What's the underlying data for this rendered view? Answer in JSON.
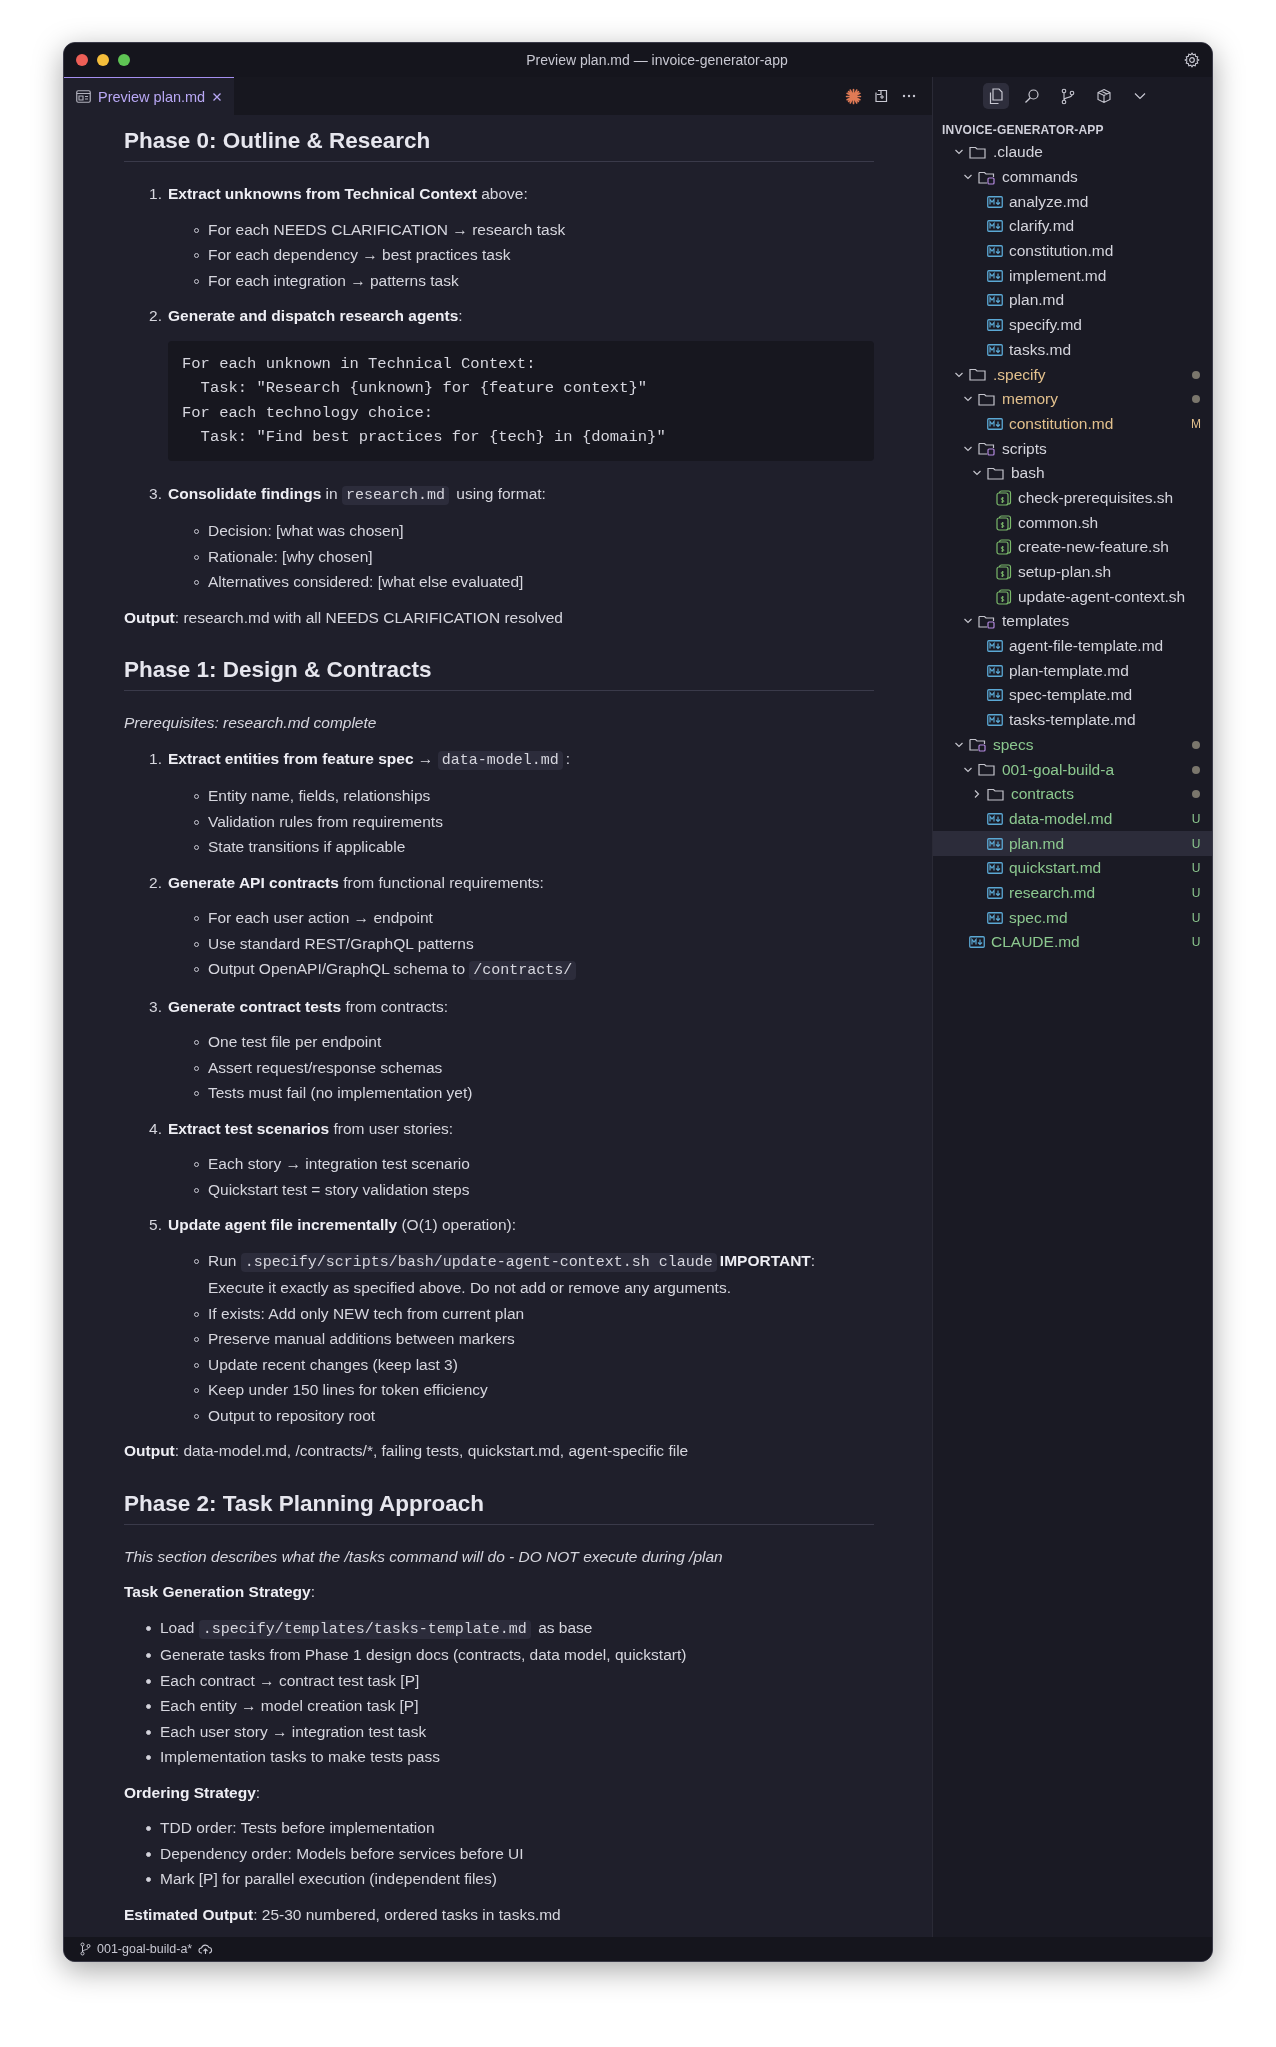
{
  "window": {
    "title": "Preview plan.md — invoice-generator-app"
  },
  "tabs": [
    {
      "label": "Preview plan.md",
      "selected": true
    }
  ],
  "document": [
    {
      "kind": "heading",
      "text": "Phase 0: Outline & Research"
    },
    {
      "kind": "ol",
      "items": [
        {
          "number": "1.",
          "text": [
            {
              "kind": "bold",
              "text": "Extract unknowns from Technical Context"
            },
            {
              "kind": "plain",
              "text": " above:"
            }
          ],
          "bullets": [
            "For each NEEDS CLARIFICATION → research task",
            "For each dependency → best practices task",
            "For each integration → patterns task"
          ]
        },
        {
          "number": "2.",
          "text": [
            {
              "kind": "bold",
              "text": "Generate and dispatch research agents"
            },
            {
              "kind": "plain",
              "text": ":"
            }
          ],
          "code": "For each unknown in Technical Context:\n  Task: \"Research {unknown} for {feature context}\"\nFor each technology choice:\n  Task: \"Find best practices for {tech} in {domain}\""
        },
        {
          "number": "3.",
          "text": [
            {
              "kind": "bold",
              "text": "Consolidate findings"
            },
            {
              "kind": "plain",
              "text": " in "
            },
            {
              "kind": "code",
              "text": "research.md"
            },
            {
              "kind": "plain",
              "text": " using format:"
            }
          ],
          "bullets": [
            "Decision: [what was chosen]",
            "Rationale: [why chosen]",
            "Alternatives considered: [what else evaluated]"
          ]
        }
      ]
    },
    {
      "kind": "paragraph",
      "text": [
        {
          "kind": "bold",
          "text": "Output"
        },
        {
          "kind": "plain",
          "text": ": research.md with all NEEDS CLARIFICATION resolved"
        }
      ]
    },
    {
      "kind": "heading",
      "text": "Phase 1: Design & Contracts"
    },
    {
      "kind": "paragraph",
      "text": [
        {
          "kind": "italic",
          "text": "Prerequisites: research.md complete"
        }
      ]
    },
    {
      "kind": "ol",
      "items": [
        {
          "number": "1.",
          "text": [
            {
              "kind": "bold",
              "text": "Extract entities from feature spec"
            },
            {
              "kind": "plain",
              "text": " → "
            },
            {
              "kind": "code",
              "text": "data-model.md"
            },
            {
              "kind": "plain",
              "text": ":"
            }
          ],
          "bullets": [
            "Entity name, fields, relationships",
            "Validation rules from requirements",
            "State transitions if applicable"
          ]
        },
        {
          "number": "2.",
          "text": [
            {
              "kind": "bold",
              "text": "Generate API contracts"
            },
            {
              "kind": "plain",
              "text": " from functional requirements:"
            }
          ],
          "bullets": [
            "For each user action → endpoint",
            "Use standard REST/GraphQL patterns",
            [
              {
                "kind": "plain",
                "text": "Output OpenAPI/GraphQL schema to "
              },
              {
                "kind": "code",
                "text": "/contracts/"
              }
            ]
          ]
        },
        {
          "number": "3.",
          "text": [
            {
              "kind": "bold",
              "text": "Generate contract tests"
            },
            {
              "kind": "plain",
              "text": " from contracts:"
            }
          ],
          "bullets": [
            "One test file per endpoint",
            "Assert request/response schemas",
            "Tests must fail (no implementation yet)"
          ]
        },
        {
          "number": "4.",
          "text": [
            {
              "kind": "bold",
              "text": "Extract test scenarios"
            },
            {
              "kind": "plain",
              "text": " from user stories:"
            }
          ],
          "bullets": [
            "Each story → integration test scenario",
            "Quickstart test = story validation steps"
          ]
        },
        {
          "number": "5.",
          "text": [
            {
              "kind": "bold",
              "text": "Update agent file incrementally"
            },
            {
              "kind": "plain",
              "text": " (O(1) operation):"
            }
          ],
          "bullets": [
            [
              {
                "kind": "plain",
                "text": "Run "
              },
              {
                "kind": "code",
                "text": ".specify/scripts/bash/update-agent-context.sh claude"
              },
              {
                "kind": "bold",
                "text": "IMPORTANT"
              },
              {
                "kind": "plain",
                "text": ": Execute it exactly as specified above. Do not add or remove any arguments."
              }
            ],
            "If exists: Add only NEW tech from current plan",
            "Preserve manual additions between markers",
            "Update recent changes (keep last 3)",
            "Keep under 150 lines for token efficiency",
            "Output to repository root"
          ]
        }
      ]
    },
    {
      "kind": "paragraph",
      "text": [
        {
          "kind": "bold",
          "text": "Output"
        },
        {
          "kind": "plain",
          "text": ": data-model.md, /contracts/*, failing tests, quickstart.md, agent-specific file"
        }
      ]
    },
    {
      "kind": "heading",
      "text": "Phase 2: Task Planning Approach"
    },
    {
      "kind": "paragraph",
      "text": [
        {
          "kind": "italic",
          "text": "This section describes what the /tasks command will do - DO NOT execute during /plan"
        }
      ]
    },
    {
      "kind": "paragraph",
      "text": [
        {
          "kind": "bold",
          "text": "Task Generation Strategy"
        },
        {
          "kind": "plain",
          "text": ":"
        }
      ]
    },
    {
      "kind": "ul",
      "items": [
        [
          {
            "kind": "plain",
            "text": "Load "
          },
          {
            "kind": "code",
            "text": ".specify/templates/tasks-template.md"
          },
          {
            "kind": "plain",
            "text": " as base"
          }
        ],
        "Generate tasks from Phase 1 design docs (contracts, data model, quickstart)",
        "Each contract → contract test task [P]",
        "Each entity → model creation task [P]",
        "Each user story → integration test task",
        "Implementation tasks to make tests pass"
      ]
    },
    {
      "kind": "paragraph",
      "text": [
        {
          "kind": "bold",
          "text": "Ordering Strategy"
        },
        {
          "kind": "plain",
          "text": ":"
        }
      ]
    },
    {
      "kind": "ul",
      "items": [
        "TDD order: Tests before implementation",
        "Dependency order: Models before services before UI",
        "Mark [P] for parallel execution (independent files)"
      ]
    },
    {
      "kind": "paragraph",
      "text": [
        {
          "kind": "bold",
          "text": "Estimated Output"
        },
        {
          "kind": "plain",
          "text": ": 25-30 numbered, ordered tasks in tasks.md"
        }
      ]
    }
  ],
  "explorer": {
    "title": "INVOICE-GENERATOR-APP",
    "tree": [
      {
        "name": ".claude",
        "kind": "folder",
        "expanded": true,
        "color": "#d4d4dc",
        "selected": false,
        "children": [
          {
            "name": "commands",
            "kind": "special-folder",
            "expanded": true,
            "color": "#d4d4dc",
            "selected": false,
            "children": [
              {
                "name": "analyze.md",
                "kind": "md-file",
                "color": "#d4d4dc",
                "selected": false
              },
              {
                "name": "clarify.md",
                "kind": "md-file",
                "color": "#d4d4dc",
                "selected": false
              },
              {
                "name": "constitution.md",
                "kind": "md-file",
                "color": "#d4d4dc",
                "selected": false
              },
              {
                "name": "implement.md",
                "kind": "md-file",
                "color": "#d4d4dc",
                "selected": false
              },
              {
                "name": "plan.md",
                "kind": "md-file",
                "color": "#d4d4dc",
                "selected": false
              },
              {
                "name": "specify.md",
                "kind": "md-file",
                "color": "#d4d4dc",
                "selected": false
              },
              {
                "name": "tasks.md",
                "kind": "md-file",
                "color": "#d4d4dc",
                "selected": false
              }
            ]
          }
        ]
      },
      {
        "name": ".specify",
        "kind": "folder",
        "expanded": true,
        "color": "#e2c08d",
        "dot": true,
        "selected": false,
        "children": [
          {
            "name": "memory",
            "kind": "folder",
            "expanded": true,
            "color": "#e2c08d",
            "dot": true,
            "selected": false,
            "children": [
              {
                "name": "constitution.md",
                "kind": "md-file",
                "color": "#e2c08d",
                "badge": "M",
                "selected": false
              }
            ]
          },
          {
            "name": "scripts",
            "kind": "special-folder",
            "expanded": true,
            "color": "#d4d4dc",
            "selected": false,
            "children": [
              {
                "name": "bash",
                "kind": "folder",
                "expanded": true,
                "color": "#d4d4dc",
                "selected": false,
                "children": [
                  {
                    "name": "check-prerequisites.sh",
                    "kind": "sh-file",
                    "color": "#d4d4dc",
                    "selected": false
                  },
                  {
                    "name": "common.sh",
                    "kind": "sh-file",
                    "color": "#d4d4dc",
                    "selected": false
                  },
                  {
                    "name": "create-new-feature.sh",
                    "kind": "sh-file",
                    "color": "#d4d4dc",
                    "selected": false
                  },
                  {
                    "name": "setup-plan.sh",
                    "kind": "sh-file",
                    "color": "#d4d4dc",
                    "selected": false
                  },
                  {
                    "name": "update-agent-context.sh",
                    "kind": "sh-file",
                    "color": "#d4d4dc",
                    "selected": false
                  }
                ]
              }
            ]
          },
          {
            "name": "templates",
            "kind": "special-folder",
            "expanded": true,
            "color": "#d4d4dc",
            "selected": false,
            "children": [
              {
                "name": "agent-file-template.md",
                "kind": "md-file",
                "color": "#d4d4dc",
                "selected": false
              },
              {
                "name": "plan-template.md",
                "kind": "md-file",
                "color": "#d4d4dc",
                "selected": false
              },
              {
                "name": "spec-template.md",
                "kind": "md-file",
                "color": "#d4d4dc",
                "selected": false
              },
              {
                "name": "tasks-template.md",
                "kind": "md-file",
                "color": "#d4d4dc",
                "selected": false
              }
            ]
          }
        ]
      },
      {
        "name": "specs",
        "kind": "special-folder",
        "expanded": true,
        "color": "#8cc88f",
        "dot": true,
        "selected": false,
        "children": [
          {
            "name": "001-goal-build-a",
            "kind": "folder",
            "expanded": true,
            "color": "#8cc88f",
            "dot": true,
            "selected": false,
            "children": [
              {
                "name": "contracts",
                "kind": "folder",
                "expanded": false,
                "color": "#8cc88f",
                "dot": true,
                "selected": false
              },
              {
                "name": "data-model.md",
                "kind": "md-file",
                "color": "#8cc88f",
                "badge": "U",
                "selected": false
              },
              {
                "name": "plan.md",
                "kind": "md-file",
                "color": "#8cc88f",
                "badge": "U",
                "selected": true
              },
              {
                "name": "quickstart.md",
                "kind": "md-file",
                "color": "#8cc88f",
                "badge": "U",
                "selected": false
              },
              {
                "name": "research.md",
                "kind": "md-file",
                "color": "#8cc88f",
                "badge": "U",
                "selected": false
              },
              {
                "name": "spec.md",
                "kind": "md-file",
                "color": "#8cc88f",
                "badge": "U",
                "selected": false
              }
            ]
          }
        ]
      },
      {
        "name": "CLAUDE.md",
        "kind": "md-file",
        "color": "#8cc88f",
        "badge": "U",
        "selected": false
      }
    ]
  },
  "status_bar": {
    "branch": "001-goal-build-a*"
  }
}
